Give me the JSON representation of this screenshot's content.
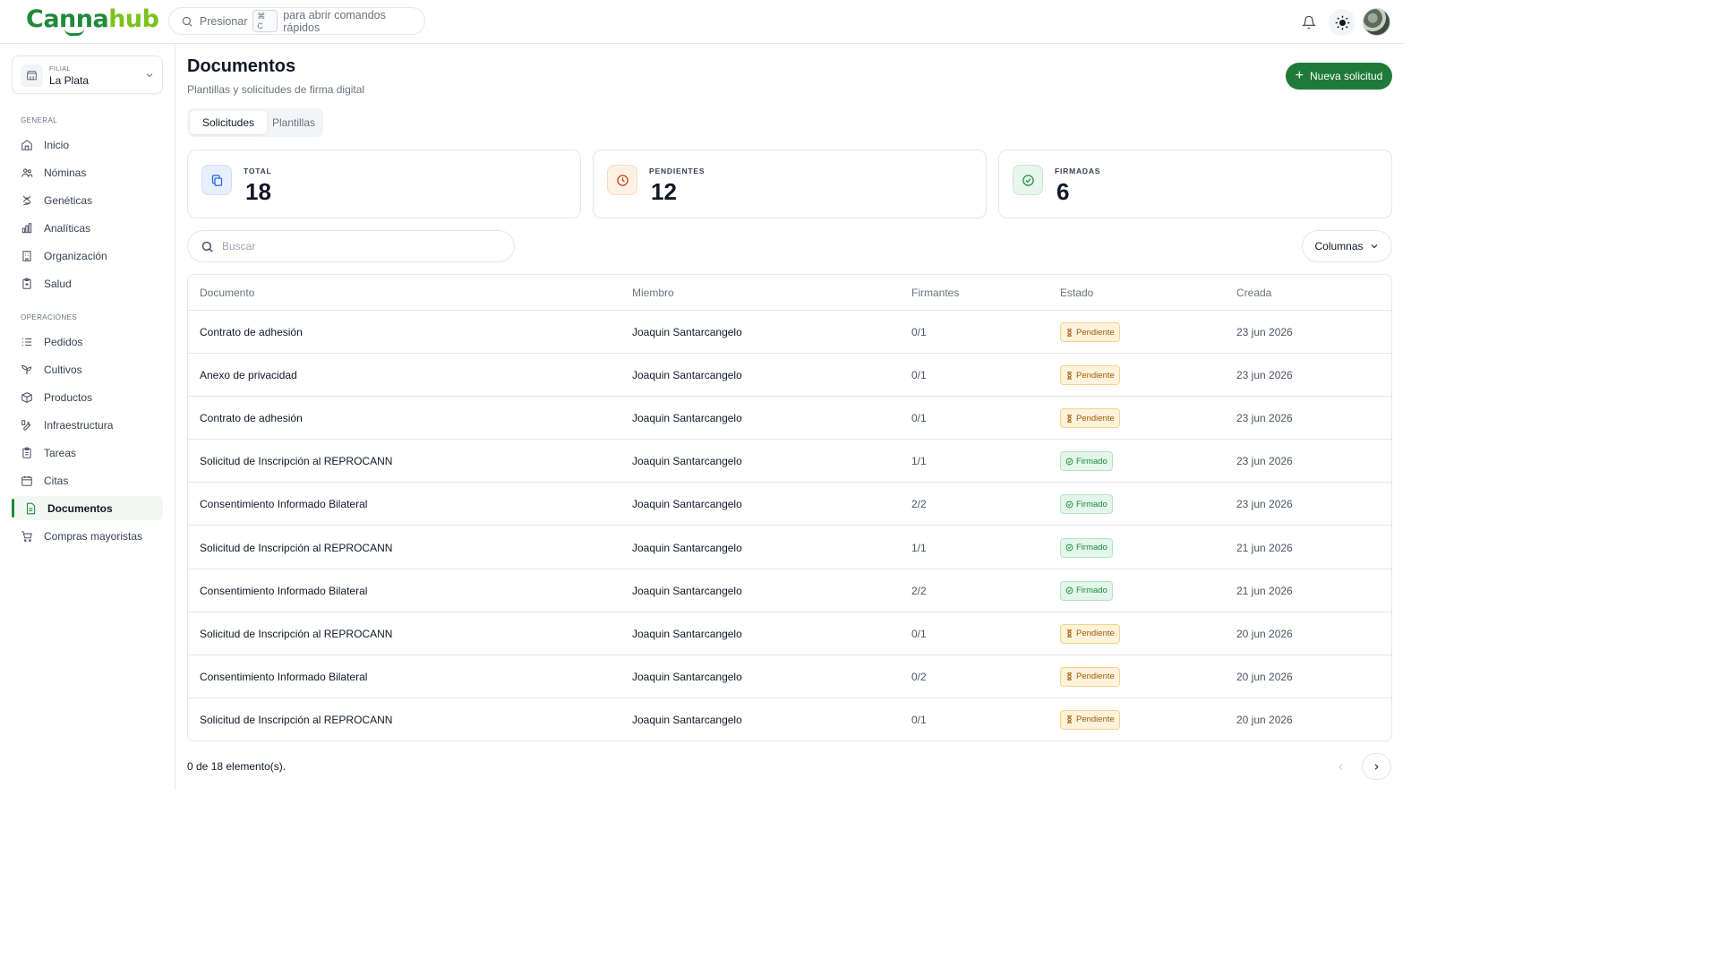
{
  "brand": {
    "part1": "Canna",
    "part2": "hub",
    "color_primary": "#1f8a3c",
    "color_secondary": "#7cc21c"
  },
  "command_bar": {
    "prefix": "Presionar",
    "shortcut": "⌘ C",
    "suffix": "para abrir comandos rápidos"
  },
  "header_icons": [
    "bell-icon",
    "sun-icon",
    "avatar"
  ],
  "sidebar": {
    "filial": {
      "caption": "FILIAL",
      "value": "La Plata"
    },
    "sections": [
      {
        "label": "GENERAL",
        "items": [
          {
            "label": "Inicio",
            "icon": "home-icon"
          },
          {
            "label": "Nóminas",
            "icon": "users-icon"
          },
          {
            "label": "Genéticas",
            "icon": "dna-icon"
          },
          {
            "label": "Analíticas",
            "icon": "bar-chart-icon"
          },
          {
            "label": "Organización",
            "icon": "building-icon"
          },
          {
            "label": "Salud",
            "icon": "clipboard-icon"
          }
        ]
      },
      {
        "label": "OPERACIONES",
        "items": [
          {
            "label": "Pedidos",
            "icon": "list-icon"
          },
          {
            "label": "Cultivos",
            "icon": "sprout-icon"
          },
          {
            "label": "Productos",
            "icon": "package-icon"
          },
          {
            "label": "Infraestructura",
            "icon": "tool-icon"
          },
          {
            "label": "Tareas",
            "icon": "clipboard-list-icon"
          },
          {
            "label": "Citas",
            "icon": "calendar-icon"
          },
          {
            "label": "Documentos",
            "icon": "file-icon",
            "active": true
          },
          {
            "label": "Compras mayoristas",
            "icon": "cart-icon"
          }
        ]
      }
    ]
  },
  "page": {
    "title": "Documentos",
    "subtitle": "Plantillas y solicitudes de firma digital",
    "new_button": "Nueva solicitud",
    "tabs": [
      {
        "label": "Solicitudes",
        "active": true
      },
      {
        "label": "Plantillas",
        "active": false
      }
    ]
  },
  "stats": [
    {
      "label": "TOTAL",
      "value": "18",
      "icon": "copy-icon",
      "color": "#2563eb"
    },
    {
      "label": "PENDIENTES",
      "value": "12",
      "icon": "clock-icon",
      "color": "#c2410c"
    },
    {
      "label": "FIRMADAS",
      "value": "6",
      "icon": "check-circle-icon",
      "color": "#1f8a3c"
    }
  ],
  "search": {
    "placeholder": "Buscar"
  },
  "columns_button": "Columnas",
  "table": {
    "headers": [
      "Documento",
      "Miembro",
      "Firmantes",
      "Estado",
      "Creada"
    ],
    "rows": [
      {
        "documento": "Contrato de adhesión",
        "miembro": "Joaquin Santarcangelo",
        "firmantes": "0/1",
        "estado": "Pendiente",
        "creada": "23 jun 2026"
      },
      {
        "documento": "Anexo de privacidad",
        "miembro": "Joaquin Santarcangelo",
        "firmantes": "0/1",
        "estado": "Pendiente",
        "creada": "23 jun 2026"
      },
      {
        "documento": "Contrato de adhesión",
        "miembro": "Joaquin Santarcangelo",
        "firmantes": "0/1",
        "estado": "Pendiente",
        "creada": "23 jun 2026"
      },
      {
        "documento": "Solicitud de Inscripción al REPROCANN",
        "miembro": "Joaquin Santarcangelo",
        "firmantes": "1/1",
        "estado": "Firmado",
        "creada": "23 jun 2026"
      },
      {
        "documento": "Consentimiento Informado Bilateral",
        "miembro": "Joaquin Santarcangelo",
        "firmantes": "2/2",
        "estado": "Firmado",
        "creada": "23 jun 2026"
      },
      {
        "documento": "Solicitud de Inscripción al REPROCANN",
        "miembro": "Joaquin Santarcangelo",
        "firmantes": "1/1",
        "estado": "Firmado",
        "creada": "21 jun 2026"
      },
      {
        "documento": "Consentimiento Informado Bilateral",
        "miembro": "Joaquin Santarcangelo",
        "firmantes": "2/2",
        "estado": "Firmado",
        "creada": "21 jun 2026"
      },
      {
        "documento": "Solicitud de Inscripción al REPROCANN",
        "miembro": "Joaquin Santarcangelo",
        "firmantes": "0/1",
        "estado": "Pendiente",
        "creada": "20 jun 2026"
      },
      {
        "documento": "Consentimiento Informado Bilateral",
        "miembro": "Joaquin Santarcangelo",
        "firmantes": "0/2",
        "estado": "Pendiente",
        "creada": "20 jun 2026"
      },
      {
        "documento": "Solicitud de Inscripción al REPROCANN",
        "miembro": "Joaquin Santarcangelo",
        "firmantes": "0/1",
        "estado": "Pendiente",
        "creada": "20 jun 2026"
      }
    ]
  },
  "footer": {
    "count": "0 de 18 elemento(s)."
  }
}
